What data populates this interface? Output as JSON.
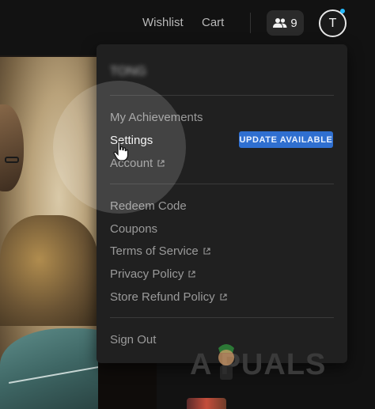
{
  "header": {
    "nav": [
      {
        "label": "Wishlist"
      },
      {
        "label": "Cart"
      }
    ],
    "friends_count": "9",
    "avatar_letter": "T"
  },
  "menu": {
    "username": "TONG",
    "group1": [
      {
        "label": "My Achievements"
      },
      {
        "label": "Settings"
      },
      {
        "label": "Account"
      }
    ],
    "update_badge": "UPDATE AVAILABLE",
    "group2": [
      {
        "label": "Redeem Code"
      },
      {
        "label": "Coupons"
      },
      {
        "label": "Terms of Service"
      },
      {
        "label": "Privacy Policy"
      },
      {
        "label": "Store Refund Policy"
      }
    ],
    "sign_out": "Sign Out"
  },
  "watermark": "A PUALS",
  "colors": {
    "accent_blue": "#2f6fd0",
    "avatar_dot": "#26bbff"
  }
}
